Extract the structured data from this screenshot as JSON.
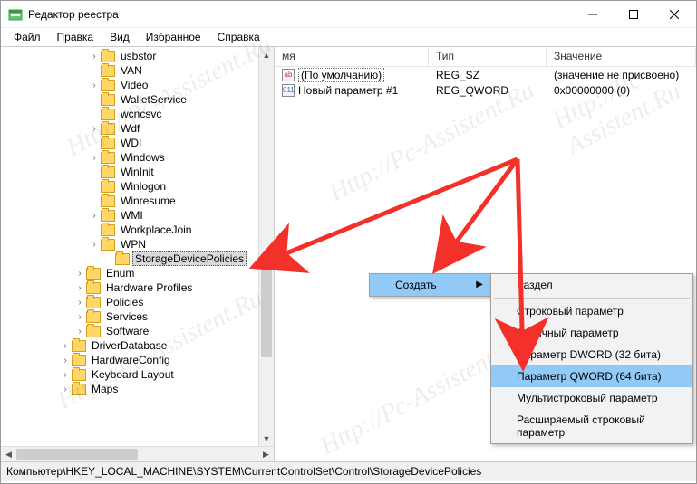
{
  "window": {
    "title": "Редактор реестра"
  },
  "menu": {
    "file": "Файл",
    "edit": "Правка",
    "view": "Вид",
    "favorites": "Избранное",
    "help": "Справка"
  },
  "tree": {
    "items": [
      {
        "indent": 6,
        "exp": ">",
        "label": "usbstor"
      },
      {
        "indent": 6,
        "exp": "",
        "label": "VAN"
      },
      {
        "indent": 6,
        "exp": ">",
        "label": "Video"
      },
      {
        "indent": 6,
        "exp": "",
        "label": "WalletService"
      },
      {
        "indent": 6,
        "exp": "",
        "label": "wcncsvc"
      },
      {
        "indent": 6,
        "exp": ">",
        "label": "Wdf"
      },
      {
        "indent": 6,
        "exp": "",
        "label": "WDI"
      },
      {
        "indent": 6,
        "exp": ">",
        "label": "Windows"
      },
      {
        "indent": 6,
        "exp": "",
        "label": "WinInit"
      },
      {
        "indent": 6,
        "exp": "",
        "label": "Winlogon"
      },
      {
        "indent": 6,
        "exp": "",
        "label": "Winresume"
      },
      {
        "indent": 6,
        "exp": ">",
        "label": "WMI"
      },
      {
        "indent": 6,
        "exp": "",
        "label": "WorkplaceJoin"
      },
      {
        "indent": 6,
        "exp": ">",
        "label": "WPN"
      },
      {
        "indent": 7,
        "exp": "",
        "label": "StorageDevicePolicies",
        "selected": true
      },
      {
        "indent": 5,
        "exp": ">",
        "label": "Enum"
      },
      {
        "indent": 5,
        "exp": ">",
        "label": "Hardware Profiles"
      },
      {
        "indent": 5,
        "exp": ">",
        "label": "Policies"
      },
      {
        "indent": 5,
        "exp": ">",
        "label": "Services"
      },
      {
        "indent": 5,
        "exp": ">",
        "label": "Software"
      },
      {
        "indent": 4,
        "exp": ">",
        "label": "DriverDatabase"
      },
      {
        "indent": 4,
        "exp": ">",
        "label": "HardwareConfig"
      },
      {
        "indent": 4,
        "exp": ">",
        "label": "Keyboard Layout"
      },
      {
        "indent": 4,
        "exp": ">",
        "label": "Maps"
      }
    ]
  },
  "list": {
    "cols": {
      "name": "мя",
      "type": "Тип",
      "value": "Значение"
    },
    "rows": [
      {
        "name": "(По умолчанию)",
        "type": "REG_SZ",
        "value": "(значение не присвоено)",
        "icon": "ab",
        "default": true
      },
      {
        "name": "Новый параметр #1",
        "type": "REG_QWORD",
        "value": "0x00000000 (0)",
        "icon": "011"
      }
    ]
  },
  "ctx": {
    "create": "Создать",
    "sub": {
      "key": "Раздел",
      "string": "Строковый параметр",
      "binary": "Двоичный параметр",
      "dword": "Параметр DWORD (32 бита)",
      "qword": "Параметр QWORD (64 бита)",
      "multi": "Мультистроковый параметр",
      "expand": "Расширяемый строковый параметр"
    }
  },
  "status": {
    "path": "Компьютер\\HKEY_LOCAL_MACHINE\\SYSTEM\\CurrentControlSet\\Control\\StorageDevicePolicies"
  },
  "watermark": "Http://Pc-Assistent.Ru"
}
